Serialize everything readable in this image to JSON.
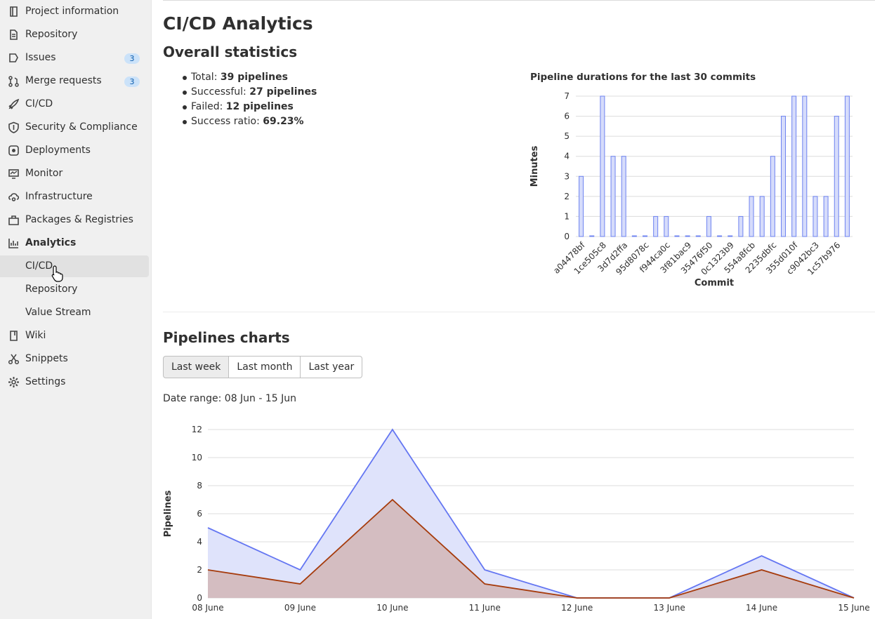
{
  "sidebar": {
    "items": [
      {
        "label": "Project information",
        "icon": "project-icon"
      },
      {
        "label": "Repository",
        "icon": "document-icon"
      },
      {
        "label": "Issues",
        "icon": "issues-icon",
        "badge": "3"
      },
      {
        "label": "Merge requests",
        "icon": "merge-request-icon",
        "badge": "3"
      },
      {
        "label": "CI/CD",
        "icon": "rocket-icon"
      },
      {
        "label": "Security & Compliance",
        "icon": "shield-icon"
      },
      {
        "label": "Deployments",
        "icon": "deployments-icon"
      },
      {
        "label": "Monitor",
        "icon": "monitor-icon"
      },
      {
        "label": "Infrastructure",
        "icon": "cloud-gear-icon"
      },
      {
        "label": "Packages & Registries",
        "icon": "package-icon"
      },
      {
        "label": "Analytics",
        "icon": "chart-icon"
      },
      {
        "label": "CI/CD"
      },
      {
        "label": "Repository"
      },
      {
        "label": "Value Stream"
      },
      {
        "label": "Wiki",
        "icon": "book-icon"
      },
      {
        "label": "Snippets",
        "icon": "snippet-icon"
      },
      {
        "label": "Settings",
        "icon": "gear-icon"
      }
    ]
  },
  "page": {
    "title": "CI/CD Analytics",
    "overall_heading": "Overall statistics",
    "stats": [
      {
        "label": "Total:",
        "value": "39 pipelines"
      },
      {
        "label": "Successful:",
        "value": "27 pipelines"
      },
      {
        "label": "Failed:",
        "value": "12 pipelines"
      },
      {
        "label": "Success ratio:",
        "value": "69.23%"
      }
    ],
    "pipelines_heading": "Pipelines charts",
    "range_buttons": [
      "Last week",
      "Last month",
      "Last year"
    ],
    "selected_range": "Last week",
    "date_range": "Date range: 08 Jun - 15 Jun"
  },
  "colors": {
    "bar_fill": "#d6dcfb",
    "bar_stroke": "#6e83f0",
    "line_all": "#6476f2",
    "line_success": "#a63b0c",
    "area_all": "#dfe3fb",
    "area_success": "#d4bdc1",
    "accent_badge": "#cbe2f9"
  },
  "chart_data": [
    {
      "type": "bar",
      "title": "Pipeline durations for the last 30 commits",
      "xlabel": "Commit",
      "ylabel": "Minutes",
      "ylim": [
        0,
        7
      ],
      "yticks": [
        0,
        1,
        2,
        3,
        4,
        5,
        6,
        7
      ],
      "tick_labels": [
        "a04478bf",
        "1ce505c8",
        "3d7d2ffa",
        "95d8078c",
        "f944ca0c",
        "3f81bac9",
        "35476f50",
        "0c1323b9",
        "554a8fcb",
        "2235dbfc",
        "355d010f",
        "c9042bc3",
        "1c57b976"
      ],
      "values": [
        3,
        0,
        7,
        4,
        4,
        0,
        0,
        1,
        1,
        0,
        0,
        0,
        1,
        0,
        0,
        1,
        2,
        2,
        4,
        6,
        7,
        7,
        2,
        2,
        6,
        7
      ]
    },
    {
      "type": "area",
      "ylabel": "Pipelines",
      "ylim": [
        0,
        12
      ],
      "yticks": [
        0,
        2,
        4,
        6,
        8,
        10,
        12
      ],
      "categories": [
        "08 June",
        "09 June",
        "10 June",
        "11 June",
        "12 June",
        "13 June",
        "14 June",
        "15 June"
      ],
      "series": [
        {
          "values": [
            5,
            2,
            12,
            2,
            0,
            0,
            3,
            0
          ]
        },
        {
          "values": [
            2,
            1,
            7,
            1,
            0,
            0,
            2,
            0
          ]
        }
      ]
    }
  ]
}
